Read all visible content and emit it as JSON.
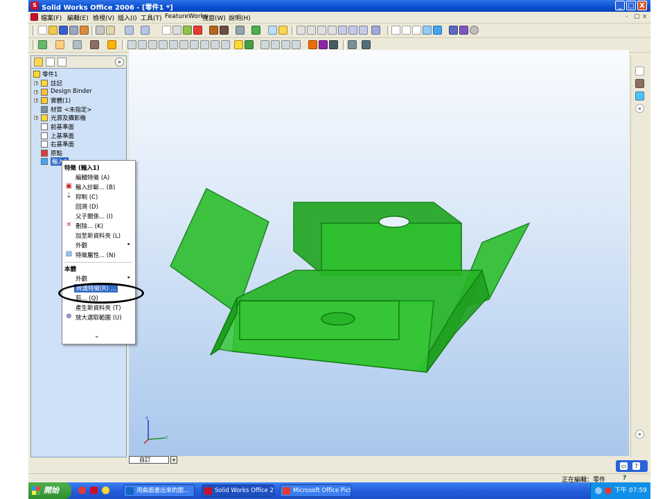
{
  "window": {
    "title": "Solid Works Office 2006 - [零件1 *]",
    "icon": "solidworks-icon",
    "controls": [
      "_",
      "▢",
      "X"
    ]
  },
  "menu": [
    "檔案(F)",
    "編輯(E)",
    "檢視(V)",
    "插入(I)",
    "工具(T)",
    "FeatureWorks",
    "視窗(W)",
    "說明(H)"
  ],
  "doc_controls": [
    "-",
    "▢",
    "x"
  ],
  "feature_tree": {
    "root": "零件1",
    "items": [
      {
        "label": "註記",
        "icon": "annotation-icon",
        "expandable": true
      },
      {
        "label": "Design Binder",
        "icon": "binder-icon",
        "expandable": true
      },
      {
        "label": "實體(1)",
        "icon": "solid-body-icon",
        "expandable": true
      },
      {
        "label": "材質 <未指定>",
        "icon": "material-icon",
        "expandable": false
      },
      {
        "label": "光源及攝影機",
        "icon": "lights-icon",
        "expandable": true
      },
      {
        "label": "前基準面",
        "icon": "plane-icon",
        "expandable": false
      },
      {
        "label": "上基準面",
        "icon": "plane-icon",
        "expandable": false
      },
      {
        "label": "右基準面",
        "icon": "plane-icon",
        "expandable": false
      },
      {
        "label": "原點",
        "icon": "origin-icon",
        "expandable": false
      },
      {
        "label": "輸入1",
        "icon": "imported-body-icon",
        "expandable": false,
        "selected": true
      }
    ]
  },
  "context_menu": {
    "header1": "特徵 (輸入1)",
    "items1": [
      {
        "label": "編輯特徵 (A)",
        "icon": ""
      },
      {
        "label": "輸入診斷... (B)",
        "icon": "diagnose-icon"
      },
      {
        "label": "抑制 (C)",
        "icon": "suppress-icon"
      },
      {
        "label": "回溯 (D)",
        "icon": ""
      },
      {
        "label": "父子關係... (I)",
        "icon": ""
      },
      {
        "label": "刪除... (K)",
        "icon": "delete-icon"
      },
      {
        "label": "加至新資料夾 (L)",
        "icon": ""
      },
      {
        "label": "外觀",
        "icon": "",
        "submenu": true
      },
      {
        "label": "特徵屬性... (N)",
        "icon": "properties-icon"
      }
    ],
    "header2": "本體",
    "items2": [
      {
        "label": "外觀",
        "icon": "",
        "submenu": true
      },
      {
        "label": "辨識特徵(R) ...",
        "icon": "",
        "highlight": true
      },
      {
        "label": "剪... (Q)",
        "icon": ""
      },
      {
        "label": "產生新資料夾 (T)",
        "icon": ""
      },
      {
        "label": "放大選取範圍 (U)",
        "icon": "zoom-icon"
      }
    ],
    "more": "⌄"
  },
  "view_tab": "自訂",
  "status": "正在編輯：零件",
  "status_help": "?",
  "taskbar": {
    "start": "開始",
    "items": [
      "用曲面畫出來的圖...",
      "Solid Works Office 20...",
      "Microsoft Office Pictur..."
    ],
    "clock": "下午 07:59"
  },
  "triad": {
    "y": "Y",
    "z": "Z"
  },
  "colors": {
    "model_fill": "#22b822",
    "model_edge": "#0f7a0f",
    "title_bar": "#0a4fd0",
    "highlight": "#316ac5"
  }
}
